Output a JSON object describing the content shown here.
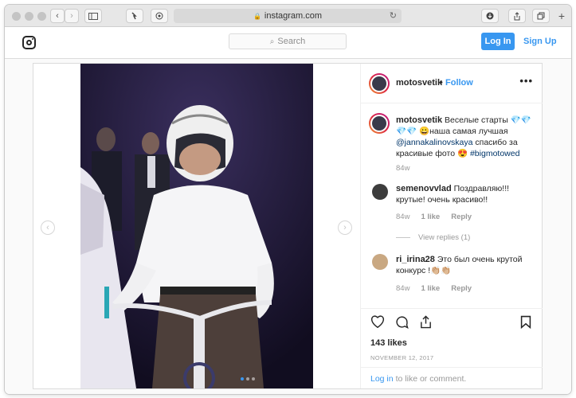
{
  "browser": {
    "url": "instagram.com",
    "new_tab": "+"
  },
  "header": {
    "search_placeholder": "Search",
    "login_label": "Log In",
    "signup_label": "Sign Up"
  },
  "post": {
    "username": "motosvetik",
    "separator": "•",
    "follow_label": "Follow",
    "more_label": "•••",
    "caption": {
      "author": "motosvetik",
      "text_1": "Веселые старты 💎💎💎💎 😀наша самая лучшая",
      "mention": "@jannakalinovskaya",
      "text_2": "спасибо за красивые фото 😍",
      "hashtag": "#bigmotowed",
      "time": "84w"
    },
    "comments": [
      {
        "author": "semenovvlad",
        "text": "Поздравляю!!!крутые! очень красиво!!",
        "time": "84w",
        "likes": "1 like",
        "reply": "Reply"
      },
      {
        "author": "ri_irina28",
        "text": "Это был очень крутой конкурс !👏🏼👏🏼",
        "time": "84w",
        "likes": "1 like",
        "reply": "Reply"
      }
    ],
    "view_replies": "View replies (1)",
    "likes": "143 likes",
    "date": "NOVEMBER 12, 2017",
    "login_link": "Log in",
    "login_text": "to like or comment."
  }
}
